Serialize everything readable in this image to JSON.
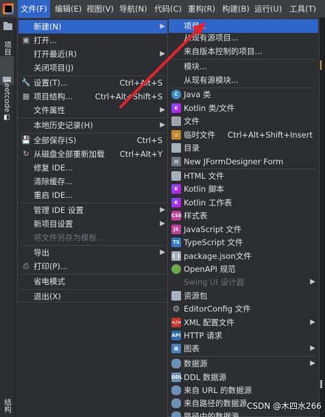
{
  "menubar": {
    "items": [
      "文件(F)",
      "编辑(E)",
      "视图(V)",
      "导航(N)",
      "代码(C)",
      "重构(R)",
      "构建(B)",
      "运行(U)",
      "工具(T)"
    ]
  },
  "left_strip": {
    "project_label": "项目",
    "leetcode_label": "Leetcode",
    "bottom_label": "结构"
  },
  "file_menu": {
    "new": "新建(N)",
    "open": "打开...",
    "open_recent": "打开最近(R)",
    "close_project": "关闭项目(J)",
    "settings": "设置(T)...",
    "settings_shortcut": "Ctrl+Alt+S",
    "project_structure": "项目结构...",
    "project_structure_shortcut": "Ctrl+Alt+Shift+S",
    "file_properties": "文件属性",
    "local_history": "本地历史记录(H)",
    "save_all": "全部保存(S)",
    "save_all_shortcut": "Ctrl+S",
    "reload_all": "从磁盘全部重新加载",
    "reload_all_shortcut": "Ctrl+Alt+Y",
    "repair_ide": "修复 IDE...",
    "invalidate_caches": "清除缓存...",
    "restart_ide": "重启 IDE...",
    "manage_ide_settings": "管理 IDE 设置",
    "new_project_settings": "新项目设置",
    "save_as_template": "将文件另存为模板...",
    "export": "导出",
    "print": "打印(P)...",
    "power_save": "省电模式",
    "exit": "退出(X)"
  },
  "new_submenu": {
    "project": "项目...",
    "project_from_existing": "从现有源项目...",
    "project_from_vcs": "来自版本控制的项目...",
    "module": "模块...",
    "module_from_existing": "从现有源模块...",
    "java_class": "Java 类",
    "kotlin_class": "Kotlin 类/文件",
    "file": "文件",
    "scratch_file": "临时文件",
    "scratch_file_shortcut": "Ctrl+Alt+Shift+Insert",
    "directory": "目录",
    "jform": "New JFormDesigner Form",
    "html_file": "HTML 文件",
    "kotlin_script": "Kotlin 脚本",
    "kotlin_worksheet": "Kotlin 工作表",
    "stylesheet": "样式表",
    "javascript_file": "JavaScript 文件",
    "typescript_file": "TypeScript 文件",
    "package_json": "package.json文件",
    "openapi": "OpenAPI 规范",
    "swing_designer": "Swing UI 设计器",
    "resource_bundle": "资源包",
    "editorconfig": "EditorConfig 文件",
    "xml_config": "XML 配置文件",
    "http_request": "HTTP 请求",
    "diagram": "图表",
    "data_source": "数据源",
    "ddl_data_source": "DDL 数据源",
    "data_source_url": "来自 URL 的数据源",
    "data_source_path": "来自路径的数据源",
    "data_source_in_path": "路径中的数据源"
  },
  "watermark": "CSDN @木四水266",
  "colors": {
    "highlight": "#2f65ca",
    "menu_bg": "#2b2d30",
    "arrow": "#e0262b"
  }
}
